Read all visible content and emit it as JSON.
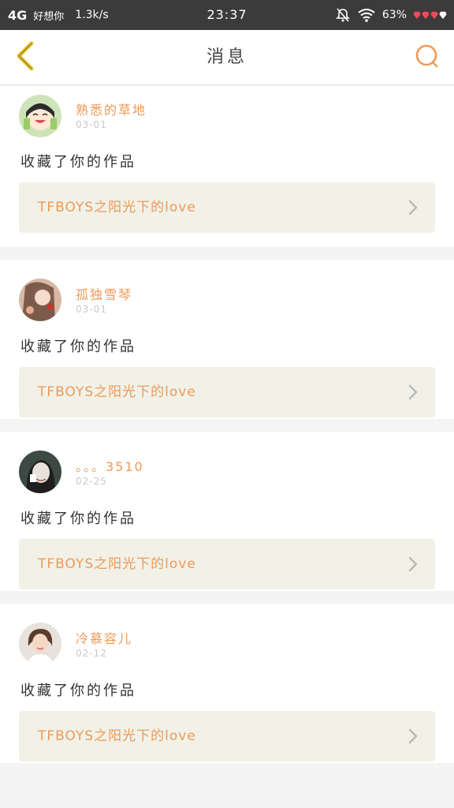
{
  "status_bar": {
    "network": "4G",
    "carrier": "好想你",
    "speed": "1.3k/s",
    "time": "23:37",
    "battery": "63%"
  },
  "header": {
    "title": "消息",
    "back_icon": "chevron-left-icon",
    "search_icon": "search-icon"
  },
  "colors": {
    "accent": "#ef9a57",
    "back_icon": "#e9c52a",
    "work_bg": "#f1f1e7"
  },
  "messages": [
    {
      "user": "熟悉的草地",
      "date": "03-01",
      "action": "收藏了你的作品",
      "work": "TFBOYS之阳光下的love"
    },
    {
      "user": "孤独雪琴",
      "date": "03-01",
      "action": "收藏了你的作品",
      "work": "TFBOYS之阳光下的love"
    },
    {
      "user": "。。。3510",
      "date": "02-25",
      "action": "收藏了你的作品",
      "work": "TFBOYS之阳光下的love"
    },
    {
      "user": "冷慕容儿",
      "date": "02-12",
      "action": "收藏了你的作品",
      "work": "TFBOYS之阳光下的love"
    }
  ]
}
